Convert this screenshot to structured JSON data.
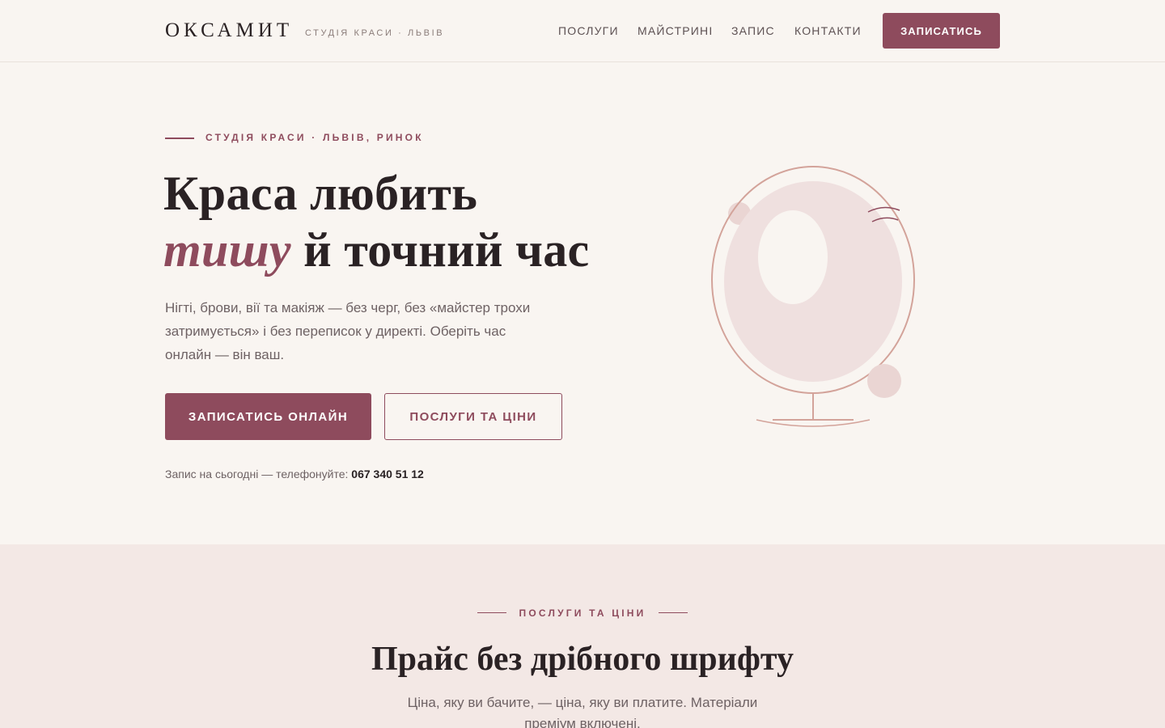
{
  "header": {
    "logo": "ОКСАМИТ",
    "logo_sub": "СТУДІЯ КРАСИ · ЛЬВІВ",
    "nav": [
      "ПОСЛУГИ",
      "МАЙСТРИНІ",
      "ЗАПИС",
      "КОНТАКТИ"
    ],
    "cta": "ЗАПИСАТИСЬ"
  },
  "hero": {
    "eyebrow": "СТУДІЯ КРАСИ · ЛЬВІВ, РИНОК",
    "title_line1": "Краса любить",
    "title_accent": "тишу",
    "title_line2_rest": " й точний час",
    "description": "Нігті, брови, вії та макіяж — без черг, без «майстер трохи затримується» і без переписок у директі. Оберіть час онлайн — він ваш.",
    "primary_button": "ЗАПИСАТИСЬ ОНЛАЙН",
    "secondary_button": "ПОСЛУГИ ТА ЦІНИ",
    "phone_prefix": "Запис на сьогодні — телефонуйте: ",
    "phone_number": "067 340 51 12"
  },
  "services": {
    "eyebrow": "ПОСЛУГИ ТА ЦІНИ",
    "title": "Прайс без дрібного шрифту",
    "description": "Ціна, яку ви бачите, — ціна, яку ви платите. Матеріали преміум включені."
  },
  "colors": {
    "accent": "#8e4b5d",
    "background": "#f9f5f1",
    "section_background": "#f3e8e5",
    "text": "#2a2224",
    "muted_text": "#6e6264",
    "mirror_stroke": "#d3a39a"
  },
  "icons": {
    "illustration": "vanity-mirror-illustration"
  }
}
